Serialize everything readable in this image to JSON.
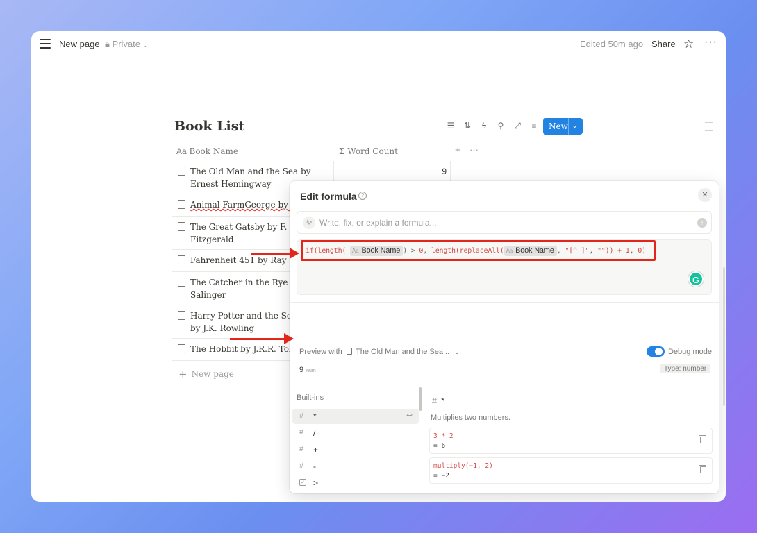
{
  "topbar": {
    "title": "New page",
    "privacy": "Private",
    "edited": "Edited 50m ago",
    "share": "Share"
  },
  "database": {
    "title": "Book List",
    "new_label": "New",
    "columns": [
      "Book Name",
      "Word Count"
    ],
    "rows": [
      {
        "name": "The Old Man and the Sea by Ernest Hemingway",
        "count": "9"
      },
      {
        "name": "Animal FarmGeorge by Orw",
        "count": ""
      },
      {
        "name": "The Great Gatsby by F. Scot Fitzgerald",
        "count": ""
      },
      {
        "name": "Fahrenheit 451 by Ray Brad",
        "count": ""
      },
      {
        "name": "The Catcher in the Rye by J. Salinger",
        "count": ""
      },
      {
        "name": "Harry Potter and the Sorcere by J.K. Rowling",
        "count": ""
      },
      {
        "name": "The Hobbit by J.R.R. Tolkier",
        "count": ""
      }
    ],
    "new_page": "New page"
  },
  "formula_panel": {
    "title": "Edit formula",
    "ai_placeholder": "Write, fix, or explain a formula...",
    "formula": {
      "p1": "if(",
      "p2": "length(",
      "chip": "Book Name",
      "p3": ") > ",
      "p4": "0",
      "p5": ", ",
      "p6": "length(replaceAll(",
      "p7": ", ",
      "p8": "\"[^ ]\"",
      "p9": ", ",
      "p10": "\"\"",
      "p11": ")) + ",
      "p12": "1",
      "p13": ", ",
      "p14": "0",
      "p15": ")"
    },
    "preview_label": "Preview with",
    "preview_page": "The Old Man and the Sea...",
    "debug_label": "Debug mode",
    "debug_on": true,
    "result_value": "9",
    "result_unit": "num",
    "type_badge": "Type: number",
    "builtins_head": "Built-ins",
    "builtins": [
      {
        "icon": "#",
        "label": "*"
      },
      {
        "icon": "#",
        "label": "/"
      },
      {
        "icon": "#",
        "label": "+"
      },
      {
        "icon": "#",
        "label": "-"
      },
      {
        "icon": "checkbox",
        "label": ">"
      },
      {
        "icon": "checkbox",
        "label": ">="
      },
      {
        "icon": "checkbox",
        "label": "<"
      }
    ],
    "detail": {
      "op": "*",
      "description": "Multiplies two numbers.",
      "examples": [
        {
          "code": "3 * 2",
          "result": "= 6"
        },
        {
          "code": "multiply(−1, 2)",
          "result": "= −2"
        }
      ]
    }
  },
  "colors": {
    "accent": "#2383e2",
    "annotation_red": "#e3261c"
  }
}
